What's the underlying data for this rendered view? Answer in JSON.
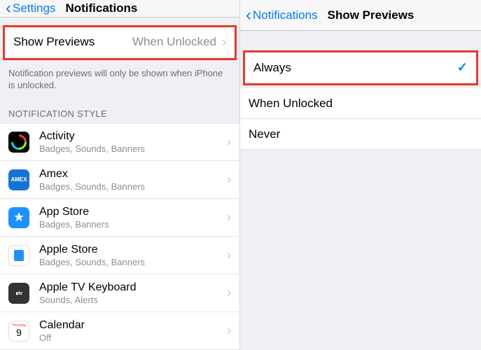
{
  "left": {
    "back_label": "Settings",
    "title": "Notifications",
    "show_previews": {
      "label": "Show Previews",
      "value": "When Unlocked"
    },
    "footer": "Notification previews will only be shown when iPhone is unlocked.",
    "section_header": "NOTIFICATION STYLE",
    "apps": [
      {
        "name": "Activity",
        "sub": "Badges, Sounds, Banners"
      },
      {
        "name": "Amex",
        "sub": "Badges, Sounds, Banners"
      },
      {
        "name": "App Store",
        "sub": "Badges, Banners"
      },
      {
        "name": "Apple Store",
        "sub": "Badges, Sounds, Banners"
      },
      {
        "name": "Apple TV Keyboard",
        "sub": "Sounds, Alerts"
      },
      {
        "name": "Calendar",
        "sub": "Off"
      }
    ],
    "calendar_icon": {
      "weekday": "Thursday",
      "day": "9"
    },
    "amex_text": "AMEX",
    "tv_text": "∎tv"
  },
  "right": {
    "back_label": "Notifications",
    "title": "Show Previews",
    "options": [
      {
        "label": "Always",
        "selected": true
      },
      {
        "label": "When Unlocked",
        "selected": false
      },
      {
        "label": "Never",
        "selected": false
      }
    ]
  }
}
